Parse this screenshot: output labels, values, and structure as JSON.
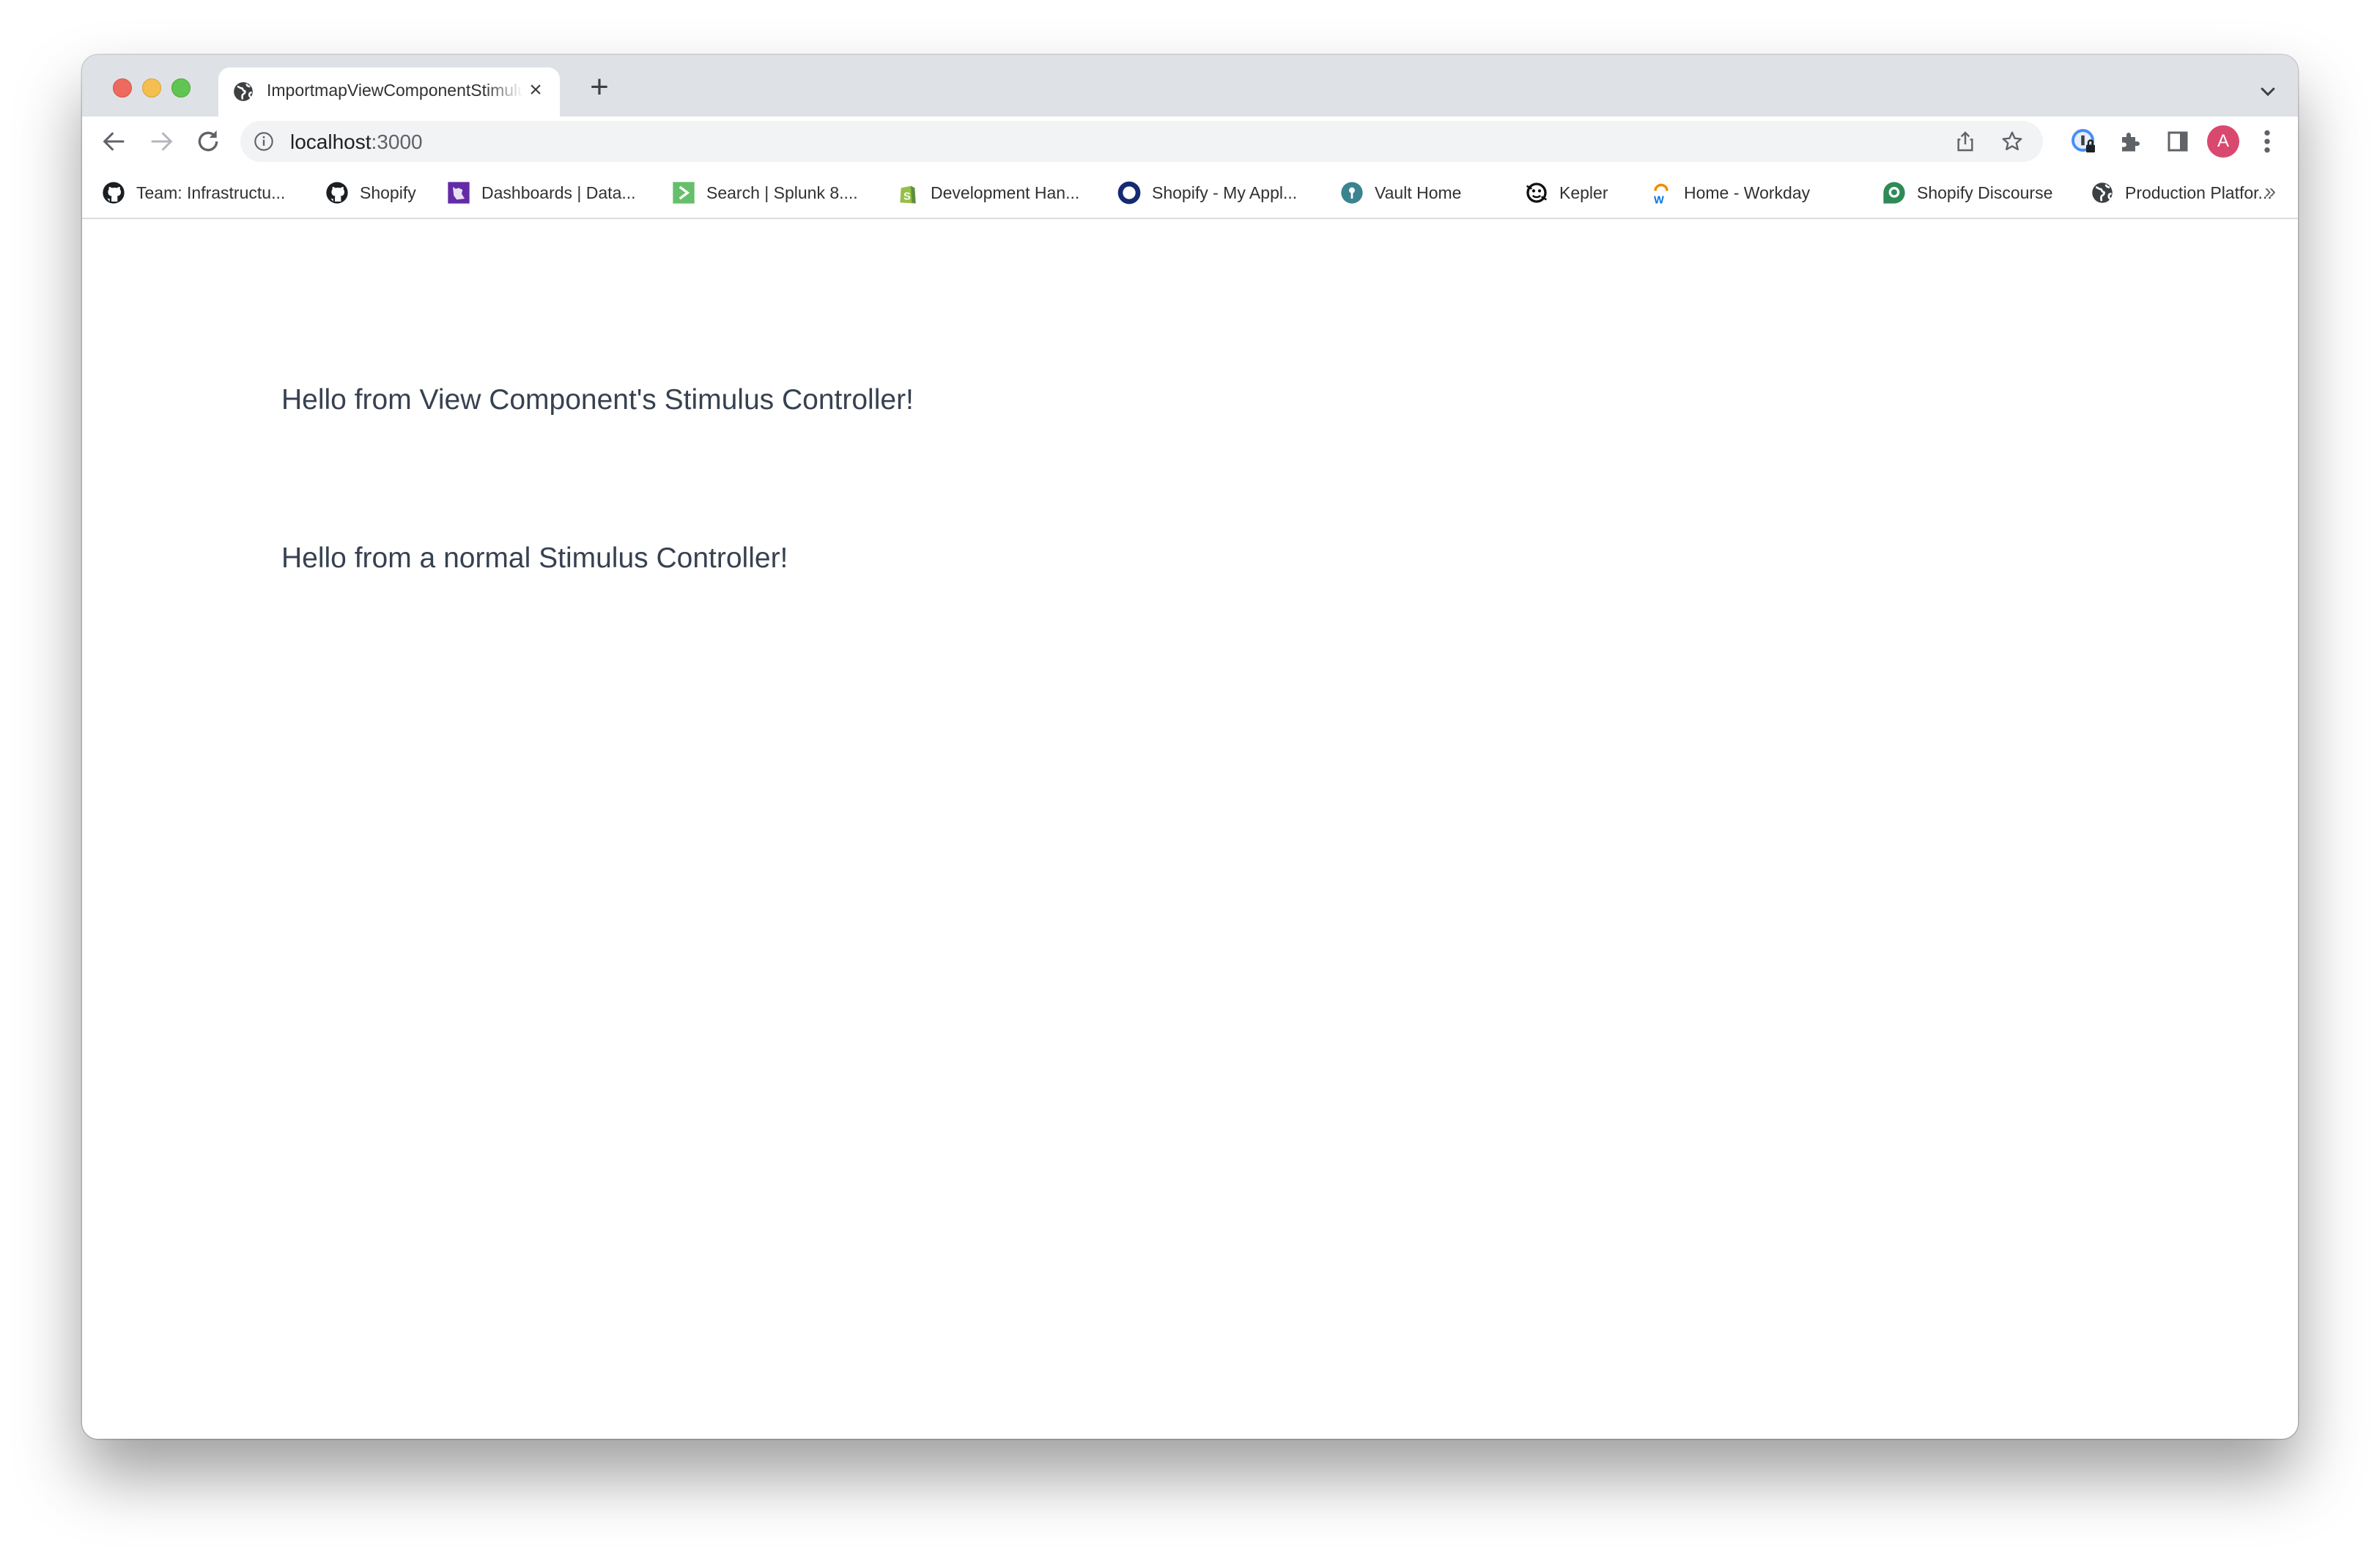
{
  "browser": {
    "tab": {
      "title": "ImportmapViewComponentStimulus",
      "close_label": "×"
    },
    "new_tab_label": "+",
    "address_bar": {
      "host": "localhost",
      "port": ":3000"
    },
    "profile_avatar_initial": "A",
    "bookmarks": [
      {
        "label": "Team: Infrastructu...",
        "icon": "github-icon"
      },
      {
        "label": "Shopify",
        "icon": "github-icon"
      },
      {
        "label": "Dashboards | Data...",
        "icon": "datadog-icon"
      },
      {
        "label": "Search | Splunk 8....",
        "icon": "splunk-icon"
      },
      {
        "label": "Development Han...",
        "icon": "shopify-bag-icon"
      },
      {
        "label": "Shopify - My Appl...",
        "icon": "ring-icon"
      },
      {
        "label": "Vault Home",
        "icon": "vault-icon"
      },
      {
        "label": "Kepler",
        "icon": "kepler-icon"
      },
      {
        "label": "Home - Workday",
        "icon": "workday-icon"
      },
      {
        "label": "Shopify Discourse",
        "icon": "discourse-icon"
      },
      {
        "label": "Production Platfor...",
        "icon": "globe-icon"
      }
    ],
    "bookmarks_overflow_label": "»"
  },
  "page": {
    "messages": [
      "Hello from View Component's Stimulus Controller!",
      "Hello from a normal Stimulus Controller!"
    ]
  },
  "colors": {
    "tab_strip": "#dee1e6",
    "omnibox": "#f1f3f4",
    "avatar": "#d9486f",
    "text": "#374151"
  }
}
